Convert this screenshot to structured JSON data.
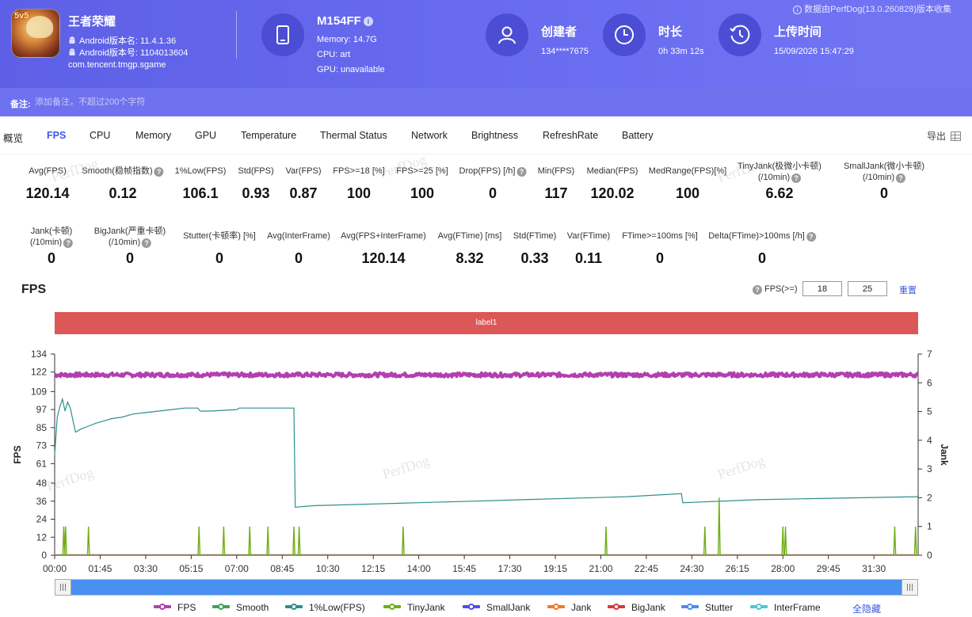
{
  "header": {
    "source_note": "数据由PerfDog(13.0.260828)版本收集",
    "app": {
      "name": "王者荣耀",
      "icon_badge": "5v5",
      "android_version_name": "Android版本名: 11.4.1.36",
      "android_version_code": "Android版本号: 1104013604",
      "package": "com.tencent.tmgp.sgame"
    },
    "device": {
      "name": "M154FF",
      "memory": "Memory: 14.7G",
      "cpu": "CPU: art",
      "gpu": "GPU: unavailable"
    },
    "creator": {
      "title": "创建者",
      "value": "134****7675"
    },
    "duration": {
      "title": "时长",
      "value": "0h 33m 12s"
    },
    "upload": {
      "title": "上传时间",
      "value": "15/09/2026 15:47:29"
    },
    "note_label": "备注:",
    "note_placeholder": "添加备注，不超过200个字符"
  },
  "tabs": [
    "概览",
    "FPS",
    "CPU",
    "Memory",
    "GPU",
    "Temperature",
    "Thermal Status",
    "Network",
    "Brightness",
    "RefreshRate",
    "Battery"
  ],
  "active_tab": "FPS",
  "export_label": "导出",
  "metrics_row1": [
    {
      "label": "Avg(FPS)",
      "value": "120.14"
    },
    {
      "label": "Smooth(稳帧指数)",
      "value": "0.12",
      "help": true
    },
    {
      "label": "1%Low(FPS)",
      "value": "106.1"
    },
    {
      "label": "Std(FPS)",
      "value": "0.93"
    },
    {
      "label": "Var(FPS)",
      "value": "0.87"
    },
    {
      "label": "FPS>=18 [%]",
      "value": "100"
    },
    {
      "label": "FPS>=25 [%]",
      "value": "100"
    },
    {
      "label": "Drop(FPS) [/h]",
      "value": "0",
      "help": true
    },
    {
      "label": "Min(FPS)",
      "value": "117"
    },
    {
      "label": "Median(FPS)",
      "value": "120.02"
    },
    {
      "label": "MedRange(FPS)[%]",
      "value": "100"
    },
    {
      "label": "TinyJank(极微小卡顿)",
      "label2": "(/10min)",
      "value": "6.62",
      "help": true
    },
    {
      "label": "SmallJank(微小卡顿)",
      "label2": "(/10min)",
      "value": "0",
      "help": true
    }
  ],
  "metrics_row2": [
    {
      "label": "Jank(卡顿)",
      "label2": "(/10min)",
      "value": "0",
      "help": true
    },
    {
      "label": "BigJank(严重卡顿)",
      "label2": "(/10min)",
      "value": "0",
      "help": true
    },
    {
      "label": "Stutter(卡顿率) [%]",
      "value": "0"
    },
    {
      "label": "Avg(InterFrame)",
      "value": "0"
    },
    {
      "label": "Avg(FPS+InterFrame)",
      "value": "120.14"
    },
    {
      "label": "Avg(FTime) [ms]",
      "value": "8.32"
    },
    {
      "label": "Std(FTime)",
      "value": "0.33"
    },
    {
      "label": "Var(FTime)",
      "value": "0.11"
    },
    {
      "label": "FTime>=100ms [%]",
      "value": "0"
    },
    {
      "label": "Delta(FTime)>100ms [/h]",
      "value": "0",
      "help": true
    }
  ],
  "chart_header": {
    "title": "FPS",
    "threshold_label": "FPS(>=)",
    "threshold_1": "18",
    "threshold_2": "25",
    "reset_label": "重置",
    "label_band": "label1"
  },
  "watermark": "PerfDog",
  "legend": {
    "items": [
      {
        "name": "FPS",
        "color": "#b23fb0"
      },
      {
        "name": "Smooth",
        "color": "#3aa35c"
      },
      {
        "name": "1%Low(FPS)",
        "color": "#2f8f8a"
      },
      {
        "name": "TinyJank",
        "color": "#6fae17"
      },
      {
        "name": "SmallJank",
        "color": "#4e4ef0"
      },
      {
        "name": "Jank",
        "color": "#f07a2c"
      },
      {
        "name": "BigJank",
        "color": "#d43a3a"
      },
      {
        "name": "Stutter",
        "color": "#4a8df0"
      },
      {
        "name": "InterFrame",
        "color": "#4fc7d9"
      }
    ],
    "hide_all_label": "全隐藏"
  },
  "chart_data": {
    "type": "line",
    "title": "FPS",
    "xlabel": "",
    "ylabel": "FPS",
    "y2label": "Jank",
    "x_ticks": [
      "00:00",
      "01:45",
      "03:30",
      "05:15",
      "07:00",
      "08:45",
      "10:30",
      "12:15",
      "14:00",
      "15:45",
      "17:30",
      "19:15",
      "21:00",
      "22:45",
      "24:30",
      "26:15",
      "28:00",
      "29:45",
      "31:30"
    ],
    "xlim_minutes": [
      0,
      33.2
    ],
    "y_ticks": [
      0,
      12,
      24,
      36,
      48,
      61,
      73,
      85,
      97,
      109,
      122,
      134
    ],
    "ylim": [
      0,
      134
    ],
    "y2_ticks": [
      0,
      1,
      2,
      3,
      4,
      5,
      6,
      7
    ],
    "y2lim": [
      0,
      7
    ],
    "series": [
      {
        "name": "FPS",
        "color": "#b23fb0",
        "summary": {
          "mean": 120.14,
          "min": 117,
          "max": 122
        }
      },
      {
        "name": "1%Low(FPS)",
        "color": "#2f8f8a",
        "x": [
          0,
          0.1,
          0.2,
          0.3,
          0.4,
          0.5,
          0.6,
          0.7,
          0.8,
          1.0,
          1.3,
          1.6,
          2.0,
          2.2,
          2.6,
          3.0,
          3.5,
          4.0,
          4.5,
          5.0,
          5.5,
          5.6,
          6.0,
          7.0,
          7.1,
          8.0,
          9.2,
          9.25,
          10.0,
          14.0,
          18.0,
          22.0,
          24.1,
          24.15,
          27.0,
          30.0,
          33.2
        ],
        "y": [
          67,
          92,
          99,
          104,
          96,
          102,
          98,
          90,
          82,
          84,
          86,
          88,
          90,
          91,
          92,
          94,
          95,
          96,
          97,
          98,
          98,
          96,
          96,
          97,
          98,
          98,
          98,
          32,
          33,
          35,
          37,
          39,
          41,
          35,
          37,
          38,
          39
        ]
      },
      {
        "name": "TinyJank",
        "color": "#6fae17",
        "x": [
          0.35,
          0.42,
          1.3,
          5.55,
          6.5,
          7.5,
          8.2,
          9.2,
          9.4,
          13.4,
          21.2,
          25.0,
          25.55,
          28.0,
          28.1,
          32.3,
          33.1
        ],
        "y": [
          1,
          1,
          1,
          1,
          1,
          1,
          1,
          1,
          1,
          1,
          1,
          1,
          2,
          1,
          1,
          1,
          1
        ]
      }
    ]
  }
}
